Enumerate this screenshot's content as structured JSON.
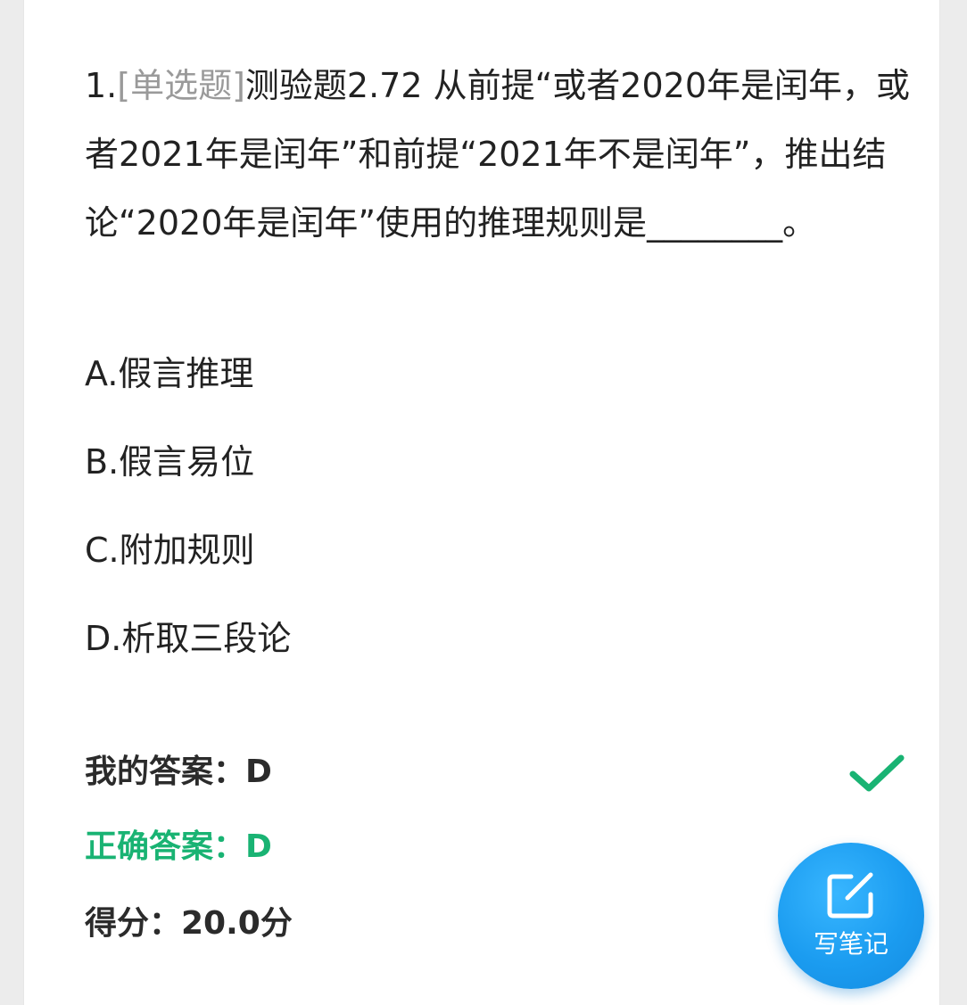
{
  "question": {
    "number": "1.",
    "type": "[单选题]",
    "text": "测验题2.72 从前提“或者2020年是闰年，或者2021年是闰年”和前提“2021年不是闰年”，推出结论“2020年是闰年”使用的推理规则是________。"
  },
  "options": {
    "a": "A.假言推理",
    "b": "B.假言易位",
    "c": "C.附加规则",
    "d": "D.析取三段论"
  },
  "result": {
    "my_answer": "我的答案：D",
    "correct_answer": "正确答案：D",
    "score": "得分：20.0分"
  },
  "note_button": {
    "label": "写笔记",
    "icon": "edit-note-icon"
  },
  "icons": {
    "check": "check-icon"
  },
  "colors": {
    "correct_green": "#19b373",
    "note_button_blue": "#1b9cf0",
    "question_type_gray": "#9a9a9a"
  }
}
